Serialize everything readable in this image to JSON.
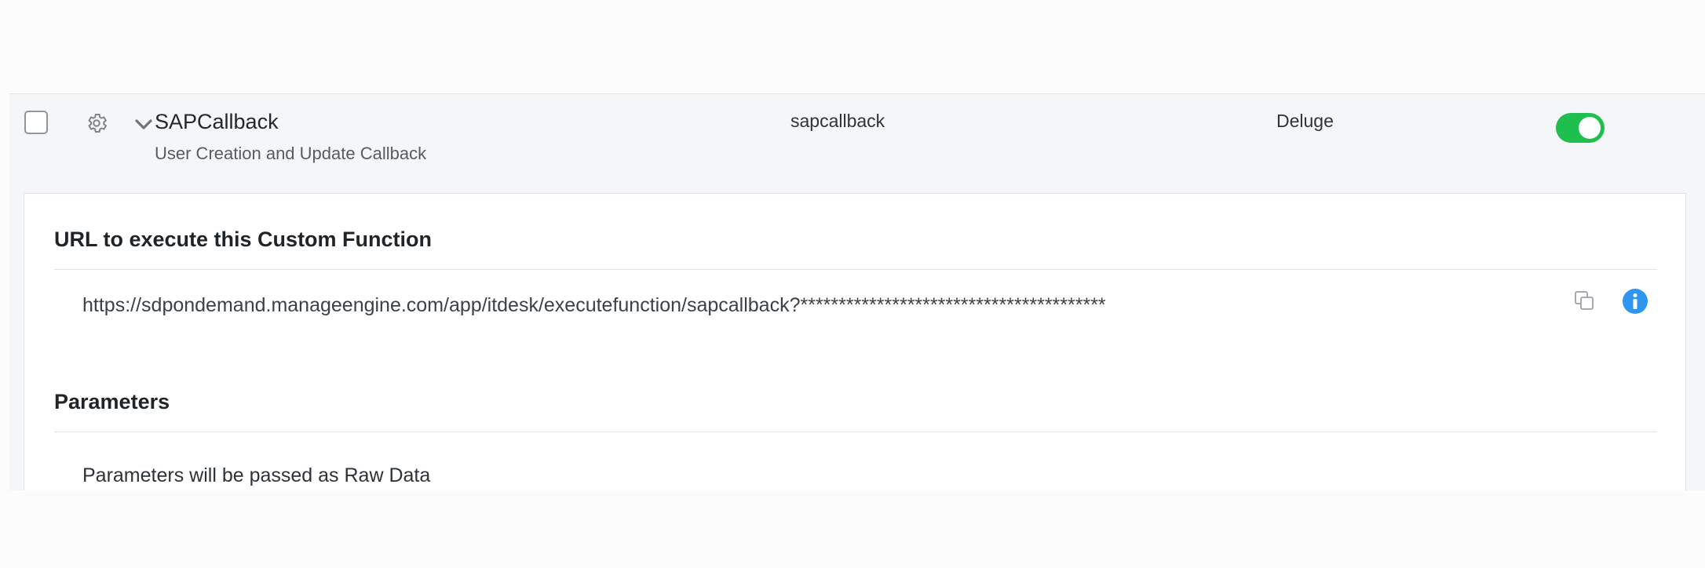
{
  "function_row": {
    "name": "SAPCallback",
    "description": "User Creation and Update Callback",
    "api_name": "sapcallback",
    "language": "Deluge",
    "enabled": true,
    "toggle_color": "#1fbf4f"
  },
  "details": {
    "url_section_title": "URL to execute this Custom Function",
    "url": "https://sdpondemand.manageengine.com/app/itdesk/executefunction/sapcallback?****************************************",
    "parameters_title": "Parameters",
    "parameters_text": "Parameters will be passed as Raw Data"
  },
  "icons": {
    "row_settings": "gear-icon",
    "row_expand": "chevron-down-icon",
    "copy": "copy-icon",
    "info": "info-icon",
    "info_color": "#2f95f0"
  }
}
